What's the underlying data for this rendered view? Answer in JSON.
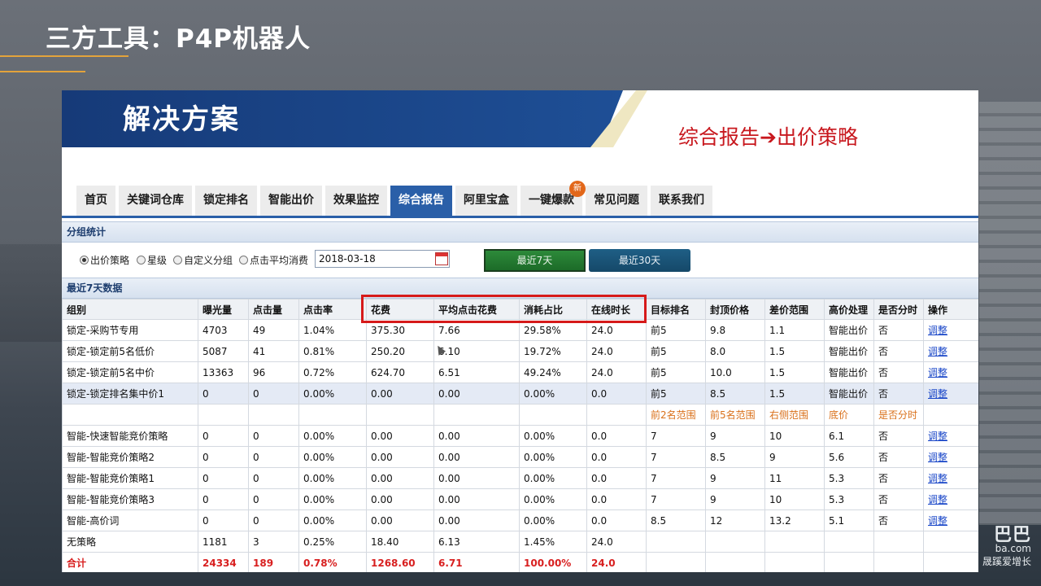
{
  "slide": {
    "title": "三方工具：P4P机器人"
  },
  "watermark": {
    "line1": "巴巴",
    "line2": "ba.com",
    "line3": "晟蹊爱增长"
  },
  "banner": {
    "title": "解决方案",
    "subtitle": "综合报告➔出价策略"
  },
  "nav": {
    "tabs": [
      {
        "label": "首页",
        "active": false
      },
      {
        "label": "关键词仓库",
        "active": false
      },
      {
        "label": "锁定排名",
        "active": false
      },
      {
        "label": "智能出价",
        "active": false
      },
      {
        "label": "效果监控",
        "active": false
      },
      {
        "label": "综合报告",
        "active": true
      },
      {
        "label": "阿里宝盒",
        "active": false
      },
      {
        "label": "一键爆款",
        "active": false,
        "badge": "新"
      },
      {
        "label": "常见问题",
        "active": false
      },
      {
        "label": "联系我们",
        "active": false
      }
    ]
  },
  "group_stats": {
    "header": "分组统计",
    "radios": [
      {
        "label": "出价策略",
        "checked": true
      },
      {
        "label": "星级",
        "checked": false
      },
      {
        "label": "自定义分组",
        "checked": false
      },
      {
        "label": "点击平均消费",
        "checked": false
      }
    ],
    "date_value": "2018-03-18",
    "btn_7days": "最近7天",
    "btn_30days": "最近30天"
  },
  "recent": {
    "header": "最近7天数据"
  },
  "table": {
    "columns": [
      "组别",
      "曝光量",
      "点击量",
      "点击率",
      "花费",
      "平均点击花费",
      "消耗占比",
      "在线时长",
      "目标排名",
      "封顶价格",
      "差价范围",
      "高价处理",
      "是否分时",
      "操作"
    ],
    "rows": [
      {
        "cells": [
          "锁定-采购节专用",
          "4703",
          "49",
          "1.04%",
          "375.30",
          "7.66",
          "29.58%",
          "24.0",
          "前5",
          "9.8",
          "1.1",
          "智能出价",
          "否"
        ],
        "action": "调整"
      },
      {
        "cells": [
          "锁定-锁定前5名低价",
          "5087",
          "41",
          "0.81%",
          "250.20",
          "6.10",
          "19.72%",
          "24.0",
          "前5",
          "8.0",
          "1.5",
          "智能出价",
          "否"
        ],
        "action": "调整"
      },
      {
        "cells": [
          "锁定-锁定前5名中价",
          "13363",
          "96",
          "0.72%",
          "624.70",
          "6.51",
          "49.24%",
          "24.0",
          "前5",
          "10.0",
          "1.5",
          "智能出价",
          "否"
        ],
        "action": "调整"
      },
      {
        "cells": [
          "锁定-锁定排名集中价1",
          "0",
          "0",
          "0.00%",
          "0.00",
          "0.00",
          "0.00%",
          "0.0",
          "前5",
          "8.5",
          "1.5",
          "智能出价",
          "否"
        ],
        "action": "调整"
      }
    ],
    "sub_header": [
      "前2名范围",
      "前5名范围",
      "右侧范围",
      "底价",
      "是否分时"
    ],
    "smart_rows": [
      {
        "cells": [
          "智能-快速智能竞价策略",
          "0",
          "0",
          "0.00%",
          "0.00",
          "0.00",
          "0.00%",
          "0.0",
          "7",
          "9",
          "10",
          "6.1",
          "否"
        ],
        "action": "调整"
      },
      {
        "cells": [
          "智能-智能竞价策略2",
          "0",
          "0",
          "0.00%",
          "0.00",
          "0.00",
          "0.00%",
          "0.0",
          "7",
          "8.5",
          "9",
          "5.6",
          "否"
        ],
        "action": "调整"
      },
      {
        "cells": [
          "智能-智能竞价策略1",
          "0",
          "0",
          "0.00%",
          "0.00",
          "0.00",
          "0.00%",
          "0.0",
          "7",
          "9",
          "11",
          "5.3",
          "否"
        ],
        "action": "调整"
      },
      {
        "cells": [
          "智能-智能竞价策略3",
          "0",
          "0",
          "0.00%",
          "0.00",
          "0.00",
          "0.00%",
          "0.0",
          "7",
          "9",
          "10",
          "5.3",
          "否"
        ],
        "action": "调整"
      },
      {
        "cells": [
          "智能-高价词",
          "0",
          "0",
          "0.00%",
          "0.00",
          "0.00",
          "0.00%",
          "0.0",
          "8.5",
          "12",
          "13.2",
          "5.1",
          "否"
        ],
        "action": "调整"
      }
    ],
    "no_strategy": [
      "无策略",
      "1181",
      "3",
      "0.25%",
      "18.40",
      "6.13",
      "1.45%",
      "24.0"
    ],
    "total": [
      "合计",
      "24334",
      "189",
      "0.78%",
      "1268.60",
      "6.71",
      "100.00%",
      "24.0"
    ]
  },
  "colors": {
    "accent_blue": "#2a5fa8",
    "highlight_red": "#d61a1a",
    "orange_text": "#d9701a",
    "link_blue": "#1a47c8"
  }
}
